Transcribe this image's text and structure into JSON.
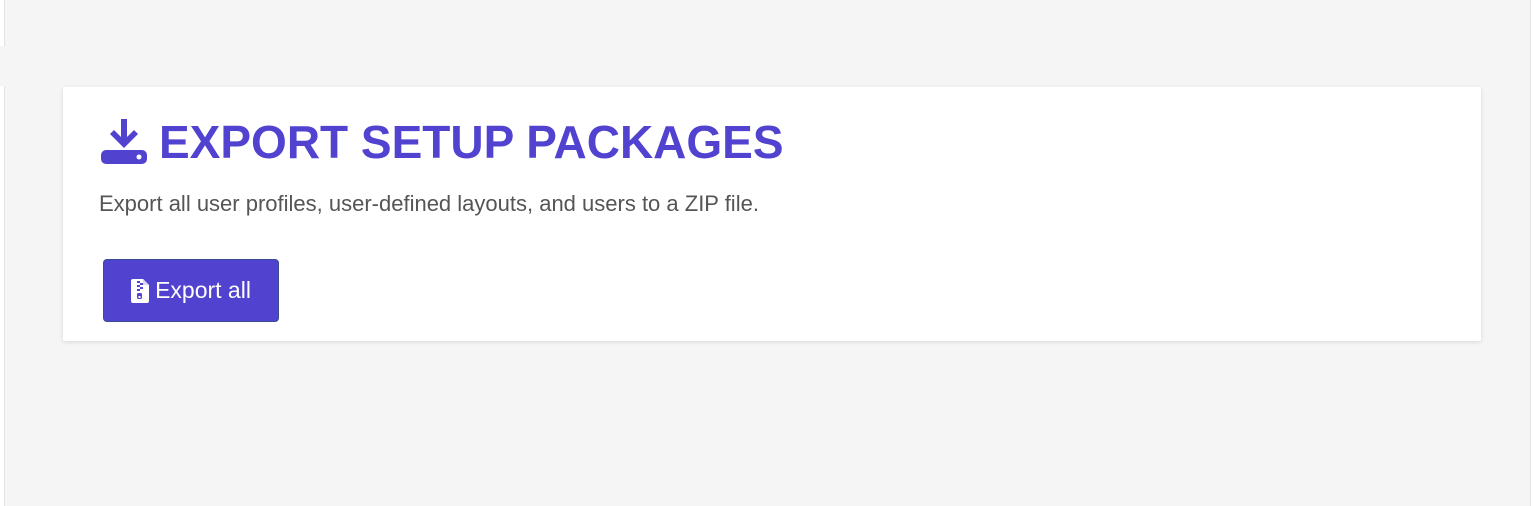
{
  "colors": {
    "accent": "#5143d0",
    "background": "#f5f5f5",
    "card": "#ffffff",
    "text_muted": "#555555"
  },
  "section": {
    "title": "EXPORT SETUP PACKAGES",
    "icon": "download-to-drive-icon",
    "description": "Export all user profiles, user-defined layouts, and users to a ZIP file."
  },
  "actions": {
    "export_all_label": "Export all",
    "export_all_icon": "zip-file-icon"
  }
}
